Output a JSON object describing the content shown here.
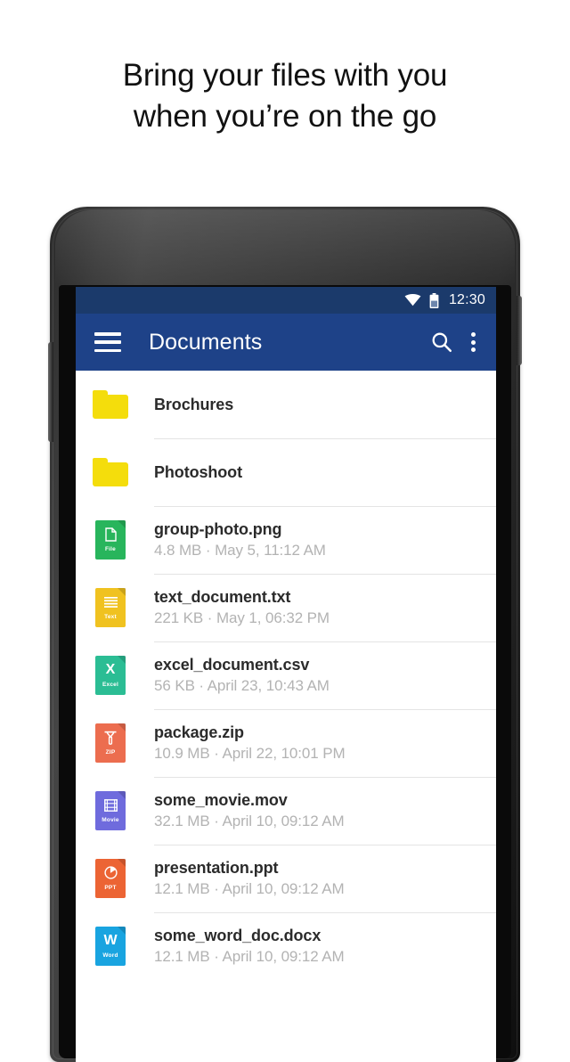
{
  "headline": {
    "line1": "Bring your files with you",
    "line2": "when you’re on the go"
  },
  "device": {
    "camera": "front-camera",
    "speaker": "earpiece-speaker"
  },
  "screen": {
    "statusbar": {
      "wifi_icon": "wifi-icon",
      "battery_icon": "battery-icon",
      "clock": "12:30",
      "background_color": "#1b3a6b"
    },
    "appbar": {
      "menu_icon": "hamburger-menu-icon",
      "title": "Documents",
      "search_icon": "search-icon",
      "overflow_icon": "overflow-menu-icon",
      "background_color": "#1e4288"
    },
    "files": [
      {
        "name": "Brochures",
        "meta": "",
        "kind": "folder",
        "icon": "folder-icon",
        "tag": "",
        "color": "#f4dd0c"
      },
      {
        "name": "Photoshoot",
        "meta": "",
        "kind": "folder",
        "icon": "folder-icon",
        "tag": "",
        "color": "#f4dd0c"
      },
      {
        "name": "group-photo.png",
        "meta": "4.8 MB · May 5, 11:12 AM",
        "kind": "file",
        "icon": "file-image-icon",
        "tag": "File",
        "color": "#28b55c"
      },
      {
        "name": "text_document.txt",
        "meta": "221 KB · May 1, 06:32 PM",
        "kind": "file",
        "icon": "file-text-icon",
        "tag": "Text",
        "color": "#f0c220"
      },
      {
        "name": "excel_document.csv",
        "meta": "56 KB · April 23, 10:43 AM",
        "kind": "file",
        "icon": "file-excel-icon",
        "tag": "Excel",
        "color": "#2bbd94"
      },
      {
        "name": "package.zip",
        "meta": "10.9 MB · April 22, 10:01 PM",
        "kind": "file",
        "icon": "file-zip-icon",
        "tag": "ZIP",
        "color": "#ec6d4f"
      },
      {
        "name": "some_movie.mov",
        "meta": "32.1 MB · April 10, 09:12 AM",
        "kind": "file",
        "icon": "file-movie-icon",
        "tag": "Movie",
        "color": "#6f6bdd"
      },
      {
        "name": "presentation.ppt",
        "meta": "12.1 MB · April 10, 09:12 AM",
        "kind": "file",
        "icon": "file-powerpoint-icon",
        "tag": "PPT",
        "color": "#ec6434"
      },
      {
        "name": "some_word_doc.docx",
        "meta": "12.1 MB · April 10, 09:12 AM",
        "kind": "file",
        "icon": "file-word-icon",
        "tag": "Word",
        "color": "#19a4e0"
      }
    ]
  }
}
